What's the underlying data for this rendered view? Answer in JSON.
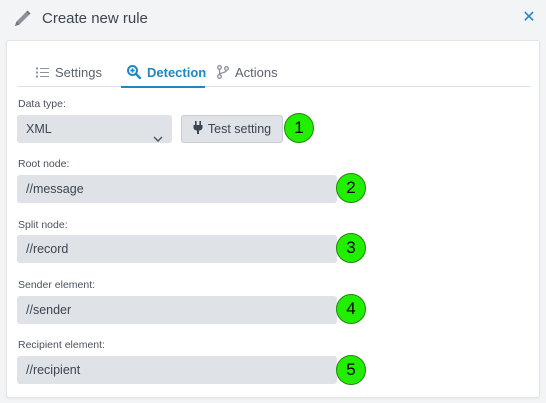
{
  "header": {
    "title": "Create new rule",
    "close_icon": "close-icon",
    "edit_icon": "pencil-icon"
  },
  "tabs": [
    {
      "label": "Settings",
      "icon": "list-icon",
      "active": false
    },
    {
      "label": "Detection",
      "icon": "search-plus-icon",
      "active": true
    },
    {
      "label": "Actions",
      "icon": "branch-icon",
      "active": false
    }
  ],
  "form": {
    "data_type": {
      "label": "Data type:",
      "value": "XML"
    },
    "test_button": {
      "label": "Test setting",
      "icon": "plug-icon"
    },
    "root_node": {
      "label": "Root node:",
      "value": "//message"
    },
    "split_node": {
      "label": "Split node:",
      "value": "//record"
    },
    "sender_element": {
      "label": "Sender element:",
      "value": "//sender"
    },
    "recipient_element": {
      "label": "Recipient element:",
      "value": "//recipient"
    }
  },
  "markers": [
    "1",
    "2",
    "3",
    "4",
    "5"
  ],
  "colors": {
    "accent": "#1e87c4",
    "marker": "#22ee00",
    "field_bg": "#dfe2e7"
  }
}
